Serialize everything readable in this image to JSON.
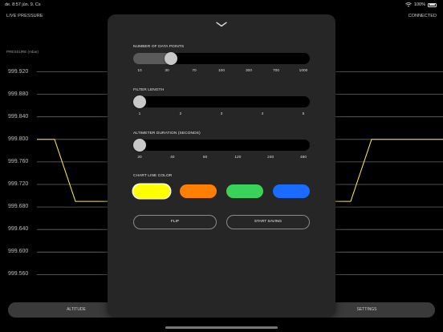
{
  "status_bar": {
    "time_date": "de. 8:57  jún. 9. Cs",
    "battery": "100%",
    "icons": [
      "wifi-icon",
      "battery-icon"
    ]
  },
  "screen": {
    "title": "LIVE PRESSURE",
    "connection": "CONNECTED",
    "axis_title": "PRESSURE (mbar)",
    "y_ticks": [
      "999.920",
      "999.880",
      "999.840",
      "999.800",
      "999.760",
      "999.720",
      "999.680",
      "999.640",
      "999.600",
      "999.560"
    ]
  },
  "chart_data": {
    "type": "line",
    "ylabel": "PRESSURE (mbar)",
    "ylim": [
      999.54,
      999.94
    ],
    "series": [
      {
        "color": "#ffee44",
        "values": [
          999.8,
          999.8,
          999.69,
          999.69,
          999.69,
          999.8,
          999.8
        ]
      }
    ]
  },
  "tabs": {
    "altitude": "ALTITUDE",
    "settings": "SETTINGS"
  },
  "settings": {
    "collapse_icon": "chevron-down-icon",
    "data_points": {
      "label": "NUMBER OF DATA POINTS",
      "ticks": [
        "10",
        "30",
        "70",
        "100",
        "300",
        "700",
        "1000"
      ],
      "selected": "30",
      "fraction": 0.19
    },
    "filter_length": {
      "label": "FILTER LENGTH",
      "ticks": [
        "1",
        "2",
        "3",
        "4",
        "5"
      ],
      "selected": "1",
      "fraction": 0.0
    },
    "altimeter_duration": {
      "label": "ALTIMETER DURATION (SECONDS)",
      "ticks": [
        "20",
        "40",
        "60",
        "120",
        "240",
        "480"
      ],
      "selected": "20",
      "fraction": 0.0
    },
    "chart_line_color": {
      "label": "CHART LINE COLOR",
      "options": [
        "#ffff00",
        "#ff7f00",
        "#3ad35a",
        "#1a6cff"
      ],
      "selected_index": 0
    },
    "flip_label": "FLIP",
    "start_saving_label": "START SAVING"
  }
}
